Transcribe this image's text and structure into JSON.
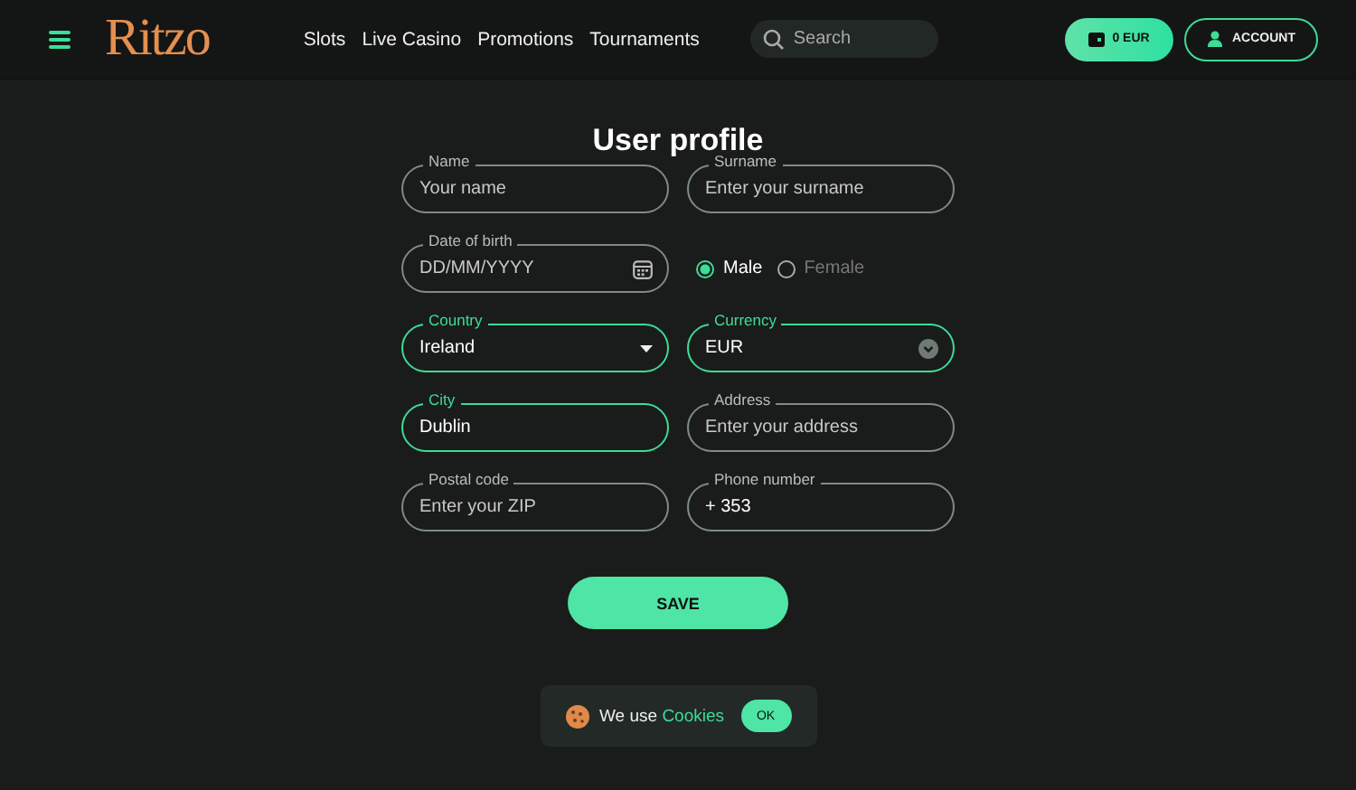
{
  "header": {
    "logo": "Ritzo",
    "nav": [
      "Slots",
      "Live Casino",
      "Promotions",
      "Tournaments"
    ],
    "search": {
      "placeholder": "Search"
    },
    "balance": "0 EUR",
    "account": "ACCOUNT"
  },
  "title": "User profile",
  "rows": [
    {
      "fields": [
        {
          "kind": "text",
          "label": "Name",
          "placeholder": "Your name",
          "highlighted": false
        },
        {
          "kind": "text",
          "label": "Surname",
          "placeholder": "Enter your surname",
          "highlighted": false
        }
      ]
    },
    {
      "fields": [
        {
          "kind": "date",
          "label": "Date of birth",
          "placeholder": "DD/MM/YYYY",
          "highlighted": false
        }
      ],
      "options": [
        {
          "label": "Male",
          "selected": true
        },
        {
          "label": "Female",
          "selected": false
        }
      ]
    },
    {
      "fields": [
        {
          "kind": "select",
          "label": "Country",
          "value": "Ireland",
          "highlighted": true
        },
        {
          "kind": "dropdown",
          "label": "Currency",
          "value": "EUR",
          "highlighted": true
        }
      ]
    },
    {
      "fields": [
        {
          "kind": "text",
          "label": "City",
          "value": "Dublin",
          "highlighted": true
        },
        {
          "kind": "text",
          "label": "Address",
          "placeholder": "Enter your address",
          "highlighted": false
        }
      ]
    },
    {
      "fields": [
        {
          "kind": "text",
          "label": "Postal code",
          "placeholder": "Enter your ZIP",
          "highlighted": false
        },
        {
          "kind": "text",
          "label": "Phone number",
          "value": "+ 353",
          "highlighted": false
        }
      ]
    }
  ],
  "save": "SAVE",
  "cookie": {
    "text": "We use",
    "link": "Cookies",
    "ok": "OK"
  }
}
